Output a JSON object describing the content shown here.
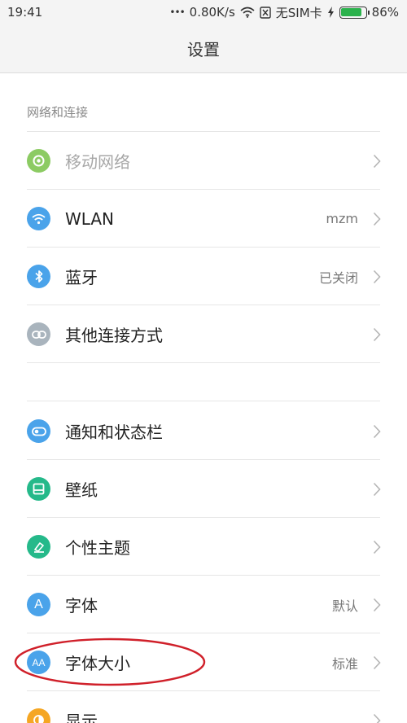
{
  "status": {
    "time": "19:41",
    "dots": "•••",
    "speed": "0.80K/s",
    "sim": "无SIM卡",
    "battery_pct": "86%",
    "battery_level": 0.86,
    "icons": [
      "wifi-icon",
      "no-sim-icon",
      "charging-icon",
      "battery-icon"
    ]
  },
  "header": {
    "title": "设置"
  },
  "sections": {
    "network": {
      "title": "网络和连接"
    }
  },
  "items": [
    {
      "label": "移动网络",
      "value": "",
      "icon": "mobile-network-icon",
      "color": "#8ccb63",
      "disabled": true
    },
    {
      "label": "WLAN",
      "value": "mzm",
      "icon": "wifi-icon",
      "color": "#4aa3ea"
    },
    {
      "label": "蓝牙",
      "value": "已关闭",
      "icon": "bluetooth-icon",
      "color": "#4aa3ea"
    },
    {
      "label": "其他连接方式",
      "value": "",
      "icon": "link-icon",
      "color": "#a9b4bd"
    },
    {
      "label": "通知和状态栏",
      "value": "",
      "icon": "toggle-icon",
      "color": "#4aa3ea"
    },
    {
      "label": "壁纸",
      "value": "",
      "icon": "wallpaper-icon",
      "color": "#25b98a"
    },
    {
      "label": "个性主题",
      "value": "",
      "icon": "theme-brush-icon",
      "color": "#25b98a"
    },
    {
      "label": "字体",
      "value": "默认",
      "icon": "font-icon",
      "color": "#4aa3ea",
      "icon_text": "A"
    },
    {
      "label": "字体大小",
      "value": "标准",
      "icon": "font-size-icon",
      "color": "#4aa3ea",
      "icon_text": "AA"
    },
    {
      "label": "显示",
      "value": "",
      "icon": "display-icon",
      "color": "#f5a623"
    }
  ],
  "annotation": {
    "shape": "ellipse",
    "color": "#d0202a",
    "target": "字体大小"
  }
}
